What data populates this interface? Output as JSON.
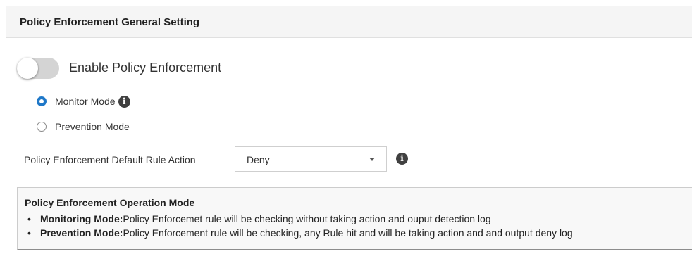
{
  "header": {
    "title": "Policy Enforcement General Setting"
  },
  "enable_toggle": {
    "label": "Enable Policy Enforcement",
    "on": false
  },
  "mode": {
    "options": [
      {
        "label": "Monitor Mode",
        "selected": true,
        "has_info": true
      },
      {
        "label": "Prevention Mode",
        "selected": false,
        "has_info": false
      }
    ]
  },
  "default_rule_action": {
    "label": "Policy Enforcement Default Rule Action",
    "value": "Deny"
  },
  "operation_mode": {
    "title": "Policy Enforcement Operation Mode",
    "items": [
      {
        "term": "Monitoring Mode:",
        "text": "Policy Enforcemet rule will be checking without taking action and ouput detection log"
      },
      {
        "term": "Prevention Mode:",
        "text": "Policy Enforcement rule will be checking, any Rule hit and will be taking action and and output deny log"
      }
    ]
  },
  "icons": {
    "info": "info-icon",
    "dropdown": "chevron-down-icon"
  },
  "colors": {
    "accent": "#1f78c8",
    "toggle_off": "#d4d4d4"
  }
}
